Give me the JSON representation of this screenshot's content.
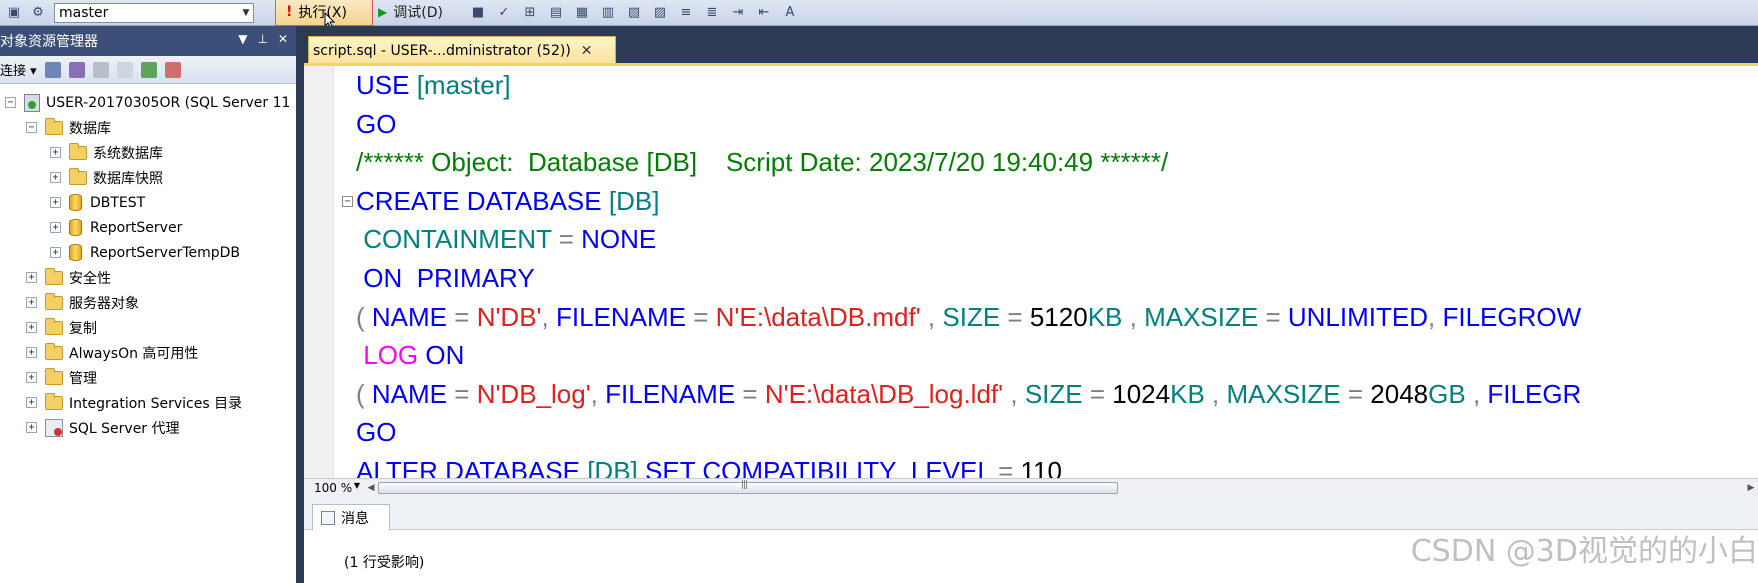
{
  "toolbar": {
    "database_selected": "master",
    "execute_label": "执行(X)",
    "debug_label": "调试(D)"
  },
  "object_explorer": {
    "title": "对象资源管理器",
    "connect_label": "连接",
    "server": "USER-20170305OR (SQL Server 11",
    "databases_folder": "数据库",
    "databases": [
      {
        "label": "系统数据库",
        "icon": "folder-icon"
      },
      {
        "label": "数据库快照",
        "icon": "folder-icon"
      },
      {
        "label": "DBTEST",
        "icon": "database-icon"
      },
      {
        "label": "ReportServer",
        "icon": "database-icon"
      },
      {
        "label": "ReportServerTempDB",
        "icon": "database-icon"
      }
    ],
    "folders": [
      "安全性",
      "服务器对象",
      "复制",
      "AlwaysOn 高可用性",
      "管理",
      "Integration Services 目录"
    ],
    "agent": "SQL Server 代理"
  },
  "editor": {
    "tab_title": "script.sql - USER-...dministrator (52))",
    "lines": [
      "USE [master]",
      "GO",
      "/****** Object:  Database [DB]    Script Date: 2023/7/20 19:40:49 ******/",
      "CREATE DATABASE [DB]",
      " CONTAINMENT = NONE",
      " ON  PRIMARY",
      "( NAME = N'DB', FILENAME = N'E:\\data\\DB.mdf' , SIZE = 5120KB , MAXSIZE = UNLIMITED, FILEGROW",
      " LOG ON",
      "( NAME = N'DB_log', FILENAME = N'E:\\data\\DB_log.ldf' , SIZE = 1024KB , MAXSIZE = 2048GB , FILEGR",
      "GO",
      "ALTER DATABASE [DB] SET COMPATIBILITY_LEVEL = 110"
    ],
    "zoom": "100 %"
  },
  "results": {
    "tab_label": "消息",
    "message": "(1 行受影响)",
    "watermark": "CSDN @3D视觉的的小白"
  }
}
